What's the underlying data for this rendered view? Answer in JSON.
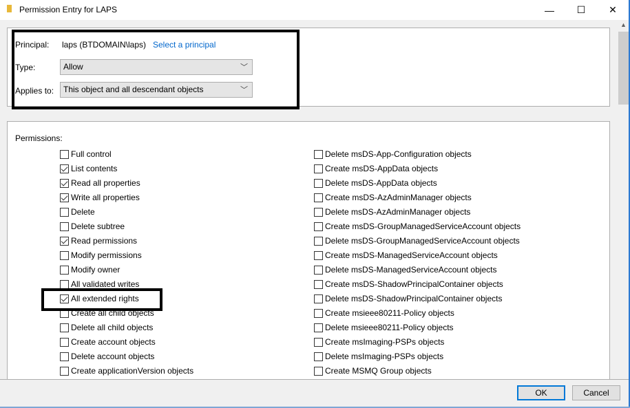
{
  "window": {
    "title": "Permission Entry for LAPS",
    "minimize": "—",
    "maximize": "☐",
    "close": "✕"
  },
  "principal": {
    "label": "Principal:",
    "value": "laps (BTDOMAIN\\laps)",
    "link": "Select a principal"
  },
  "type": {
    "label": "Type:",
    "value": "Allow"
  },
  "applies": {
    "label": "Applies to:",
    "value": "This object and all descendant objects"
  },
  "permissions_label": "Permissions:",
  "left": [
    {
      "label": "Full control",
      "checked": false
    },
    {
      "label": "List contents",
      "checked": true
    },
    {
      "label": "Read all properties",
      "checked": true
    },
    {
      "label": "Write all properties",
      "checked": true
    },
    {
      "label": "Delete",
      "checked": false
    },
    {
      "label": "Delete subtree",
      "checked": false
    },
    {
      "label": "Read permissions",
      "checked": true
    },
    {
      "label": "Modify permissions",
      "checked": false
    },
    {
      "label": "Modify owner",
      "checked": false
    },
    {
      "label": "All validated writes",
      "checked": false
    },
    {
      "label": "All extended rights",
      "checked": true
    },
    {
      "label": "Create all child objects",
      "checked": false
    },
    {
      "label": "Delete all child objects",
      "checked": false
    },
    {
      "label": "Create account objects",
      "checked": false
    },
    {
      "label": "Delete account objects",
      "checked": false
    },
    {
      "label": "Create applicationVersion objects",
      "checked": false
    }
  ],
  "right": [
    {
      "label": "Delete msDS-App-Configuration objects",
      "checked": false
    },
    {
      "label": "Create msDS-AppData objects",
      "checked": false
    },
    {
      "label": "Delete msDS-AppData objects",
      "checked": false
    },
    {
      "label": "Create msDS-AzAdminManager objects",
      "checked": false
    },
    {
      "label": "Delete msDS-AzAdminManager objects",
      "checked": false
    },
    {
      "label": "Create msDS-GroupManagedServiceAccount objects",
      "checked": false
    },
    {
      "label": "Delete msDS-GroupManagedServiceAccount objects",
      "checked": false
    },
    {
      "label": "Create msDS-ManagedServiceAccount objects",
      "checked": false
    },
    {
      "label": "Delete msDS-ManagedServiceAccount objects",
      "checked": false
    },
    {
      "label": "Create msDS-ShadowPrincipalContainer objects",
      "checked": false
    },
    {
      "label": "Delete msDS-ShadowPrincipalContainer objects",
      "checked": false
    },
    {
      "label": "Create msieee80211-Policy objects",
      "checked": false
    },
    {
      "label": "Delete msieee80211-Policy objects",
      "checked": false
    },
    {
      "label": "Create msImaging-PSPs objects",
      "checked": false
    },
    {
      "label": "Delete msImaging-PSPs objects",
      "checked": false
    },
    {
      "label": "Create MSMQ Group objects",
      "checked": false
    }
  ],
  "buttons": {
    "ok": "OK",
    "cancel": "Cancel"
  },
  "colors": {
    "accent": "#0078d7",
    "link": "#0066cc"
  }
}
